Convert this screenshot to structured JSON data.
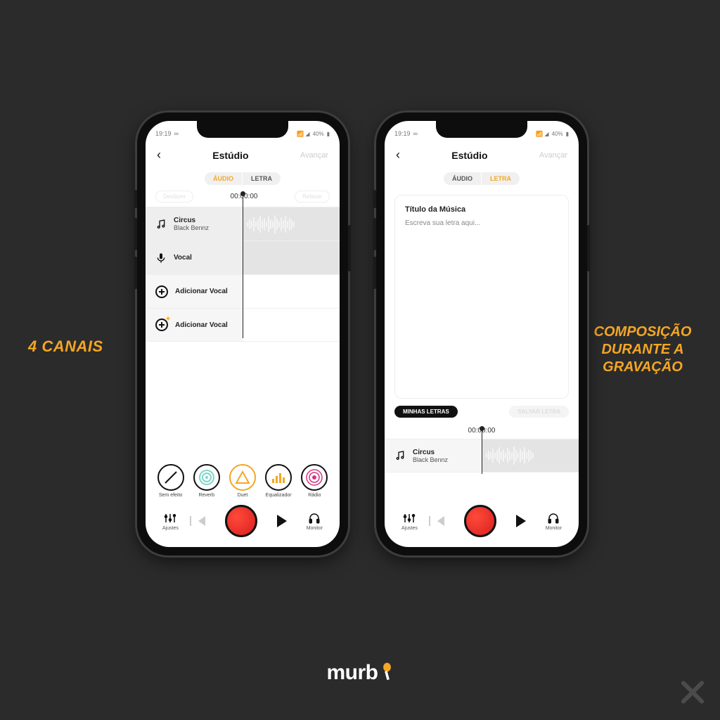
{
  "colors": {
    "accent": "#f5a623",
    "record": "#e52a2a"
  },
  "promo": {
    "left_label": "4 CANAIS",
    "right_label": "COMPOSIÇÃO DURANTE A GRAVAÇÃO",
    "logo": "murb"
  },
  "status": {
    "time": "19:19",
    "battery": "40%"
  },
  "nav": {
    "title": "Estúdio",
    "action": "Avançar"
  },
  "tabs": {
    "audio": "ÁUDIO",
    "letra": "LETRA"
  },
  "timeline": {
    "undo": "Desfazer",
    "redo": "Refazer",
    "timecode": "00:00:00"
  },
  "left_phone": {
    "tracks": [
      {
        "title": "Circus",
        "sub": "Black Bennz",
        "icon": "music",
        "wave": true
      },
      {
        "title": "Vocal",
        "icon": "mic",
        "wave": false,
        "filled": true
      },
      {
        "title": "Adicionar Vocal",
        "icon": "plus",
        "wave": false
      },
      {
        "title": "Adicionar Vocal",
        "icon": "plus-gold",
        "wave": false
      }
    ],
    "effects": [
      {
        "label": "Sem efeito"
      },
      {
        "label": "Reverb"
      },
      {
        "label": "Duet"
      },
      {
        "label": "Equalizador"
      },
      {
        "label": "Rádio"
      }
    ],
    "transport": {
      "ajustes": "Ajustes",
      "monitor": "Monitor"
    }
  },
  "right_phone": {
    "lyrics": {
      "title": "Título da Música",
      "placeholder": "Escreva sua letra aqui..."
    },
    "chips": {
      "my_lyrics": "MINHAS LETRAS",
      "save": "SALVAR LETRA"
    },
    "track": {
      "title": "Circus",
      "sub": "Black Bennz"
    },
    "transport": {
      "ajustes": "Ajustes",
      "monitor": "Monitor"
    }
  }
}
